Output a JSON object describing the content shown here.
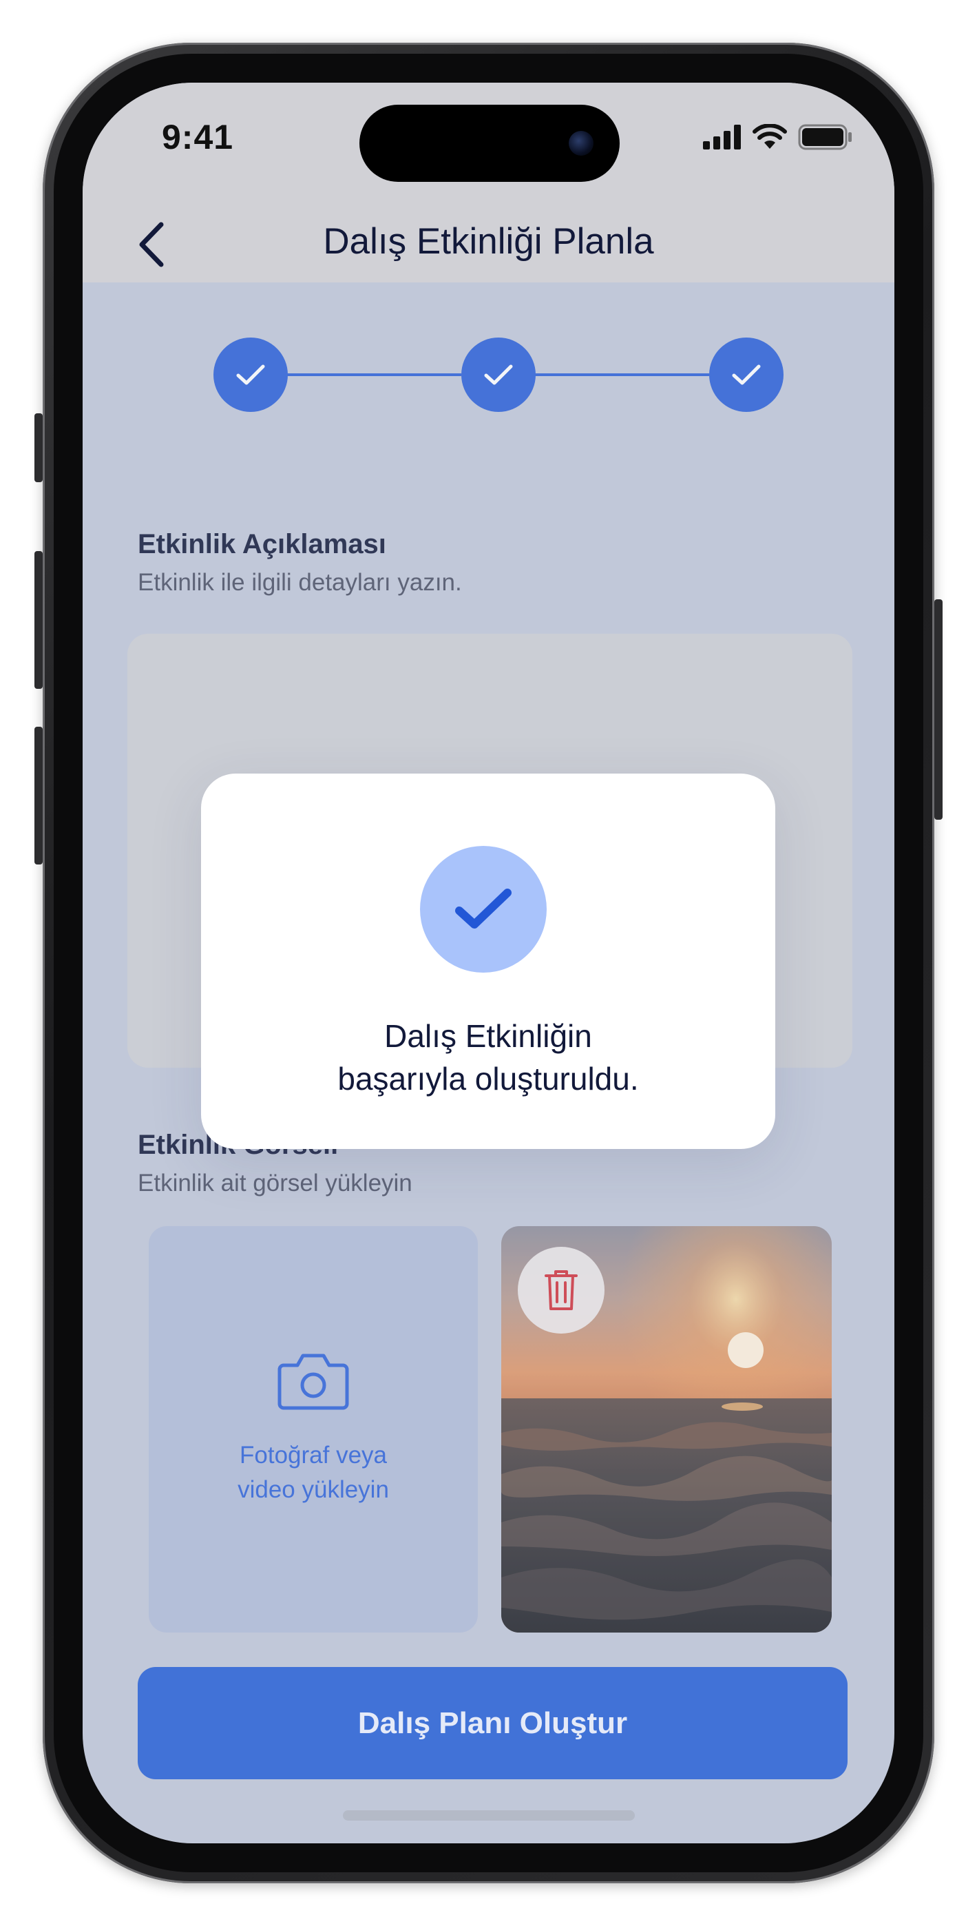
{
  "status_bar": {
    "time": "9:41",
    "icons": [
      "cellular-signal-icon",
      "wifi-icon",
      "battery-icon"
    ]
  },
  "header": {
    "title": "Dalış Etkinliği Planla",
    "back_icon": "chevron-left-icon"
  },
  "stepper": {
    "total_steps": 3,
    "completed_steps": 3,
    "step_icon": "check-icon",
    "color": "#2b60d8"
  },
  "description_section": {
    "title": "Etkinlik Açıklaması",
    "subtitle": "Etkinlik ile ilgili detayları yazın.",
    "value": ""
  },
  "image_section": {
    "title": "Etkinlik Görseli",
    "subtitle": "Etkinlik ait görsel yükleyin",
    "upload_icon": "camera-icon",
    "upload_label_line1": "Fotoğraf veya",
    "upload_label_line2": "video yükleyin",
    "delete_icon": "trash-icon"
  },
  "primary_button": {
    "label": "Dalış Planı Oluştur",
    "color": "#2660d7"
  },
  "success_modal": {
    "icon": "check-icon",
    "message_line1": "Dalış Etkinliğin",
    "message_line2": "başarıyla oluşturuldu."
  }
}
